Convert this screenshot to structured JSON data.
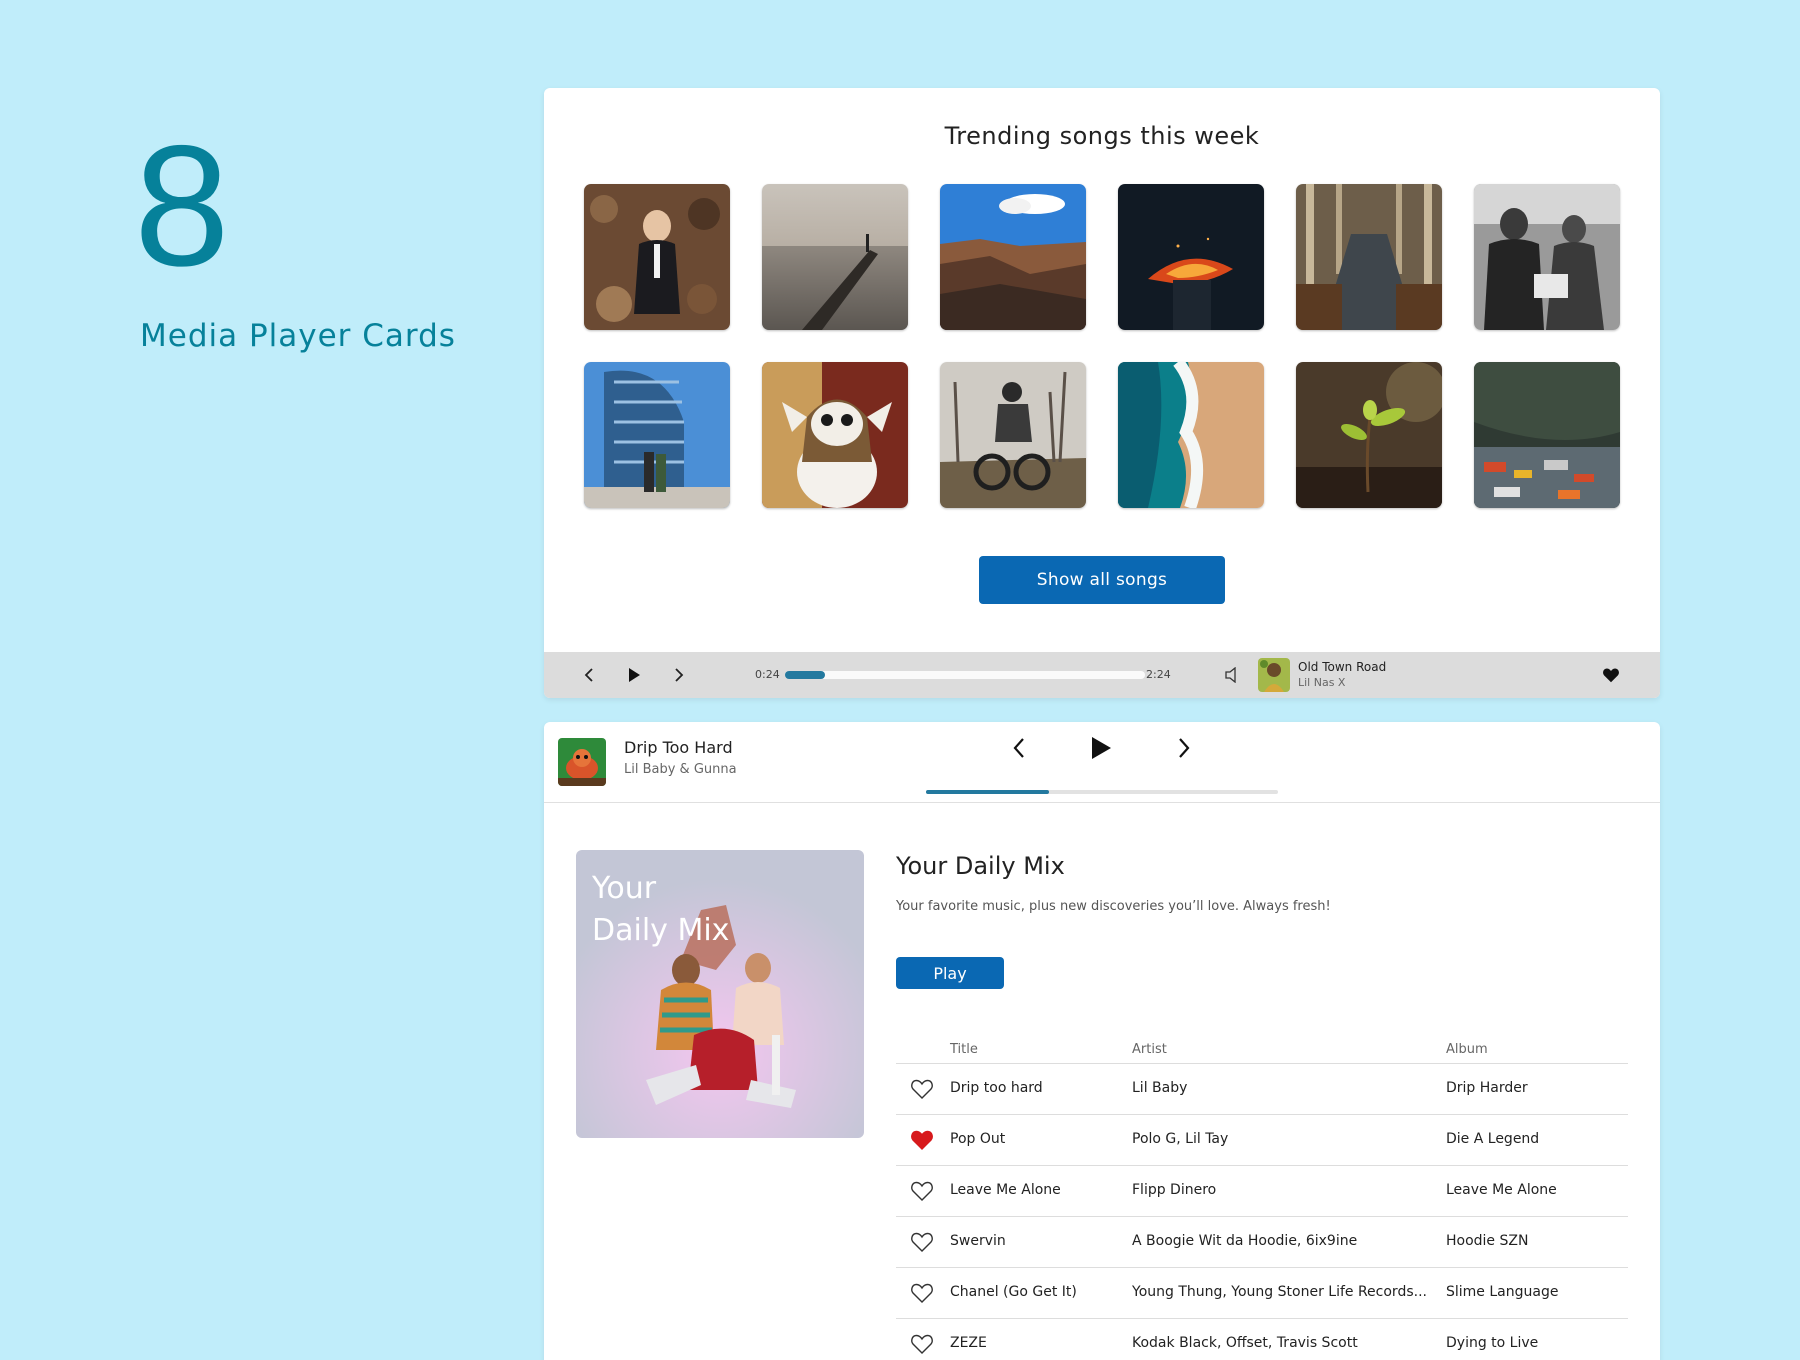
{
  "hero": {
    "number": "8",
    "label": "Media Player Cards"
  },
  "trending": {
    "title": "Trending songs this week",
    "tiles": [
      "portrait-in-leaves",
      "pier-at-sunset",
      "canyon-vista",
      "burning-sparks",
      "library-hall",
      "crowd-protest",
      "glass-tower",
      "furry-mascot",
      "motorbike-rider",
      "beach-waves",
      "sapling-sprout",
      "harbor-boats"
    ],
    "show_all_label": "Show all songs",
    "player": {
      "prev_icon": "chevron-left-icon",
      "play_icon": "play-icon",
      "next_icon": "chevron-right-icon",
      "elapsed": "0:24",
      "duration": "2:24",
      "progress": 0.11,
      "now_playing_title": "Old Town Road",
      "now_playing_artist": "Lil Nas X",
      "volume_icon": "speaker-icon",
      "like_icon": "heart-icon"
    }
  },
  "mini_player": {
    "title": "Drip Too Hard",
    "artist": "Lil Baby & Gunna",
    "progress": 0.35
  },
  "mix": {
    "art_text_line1": "Your",
    "art_text_line2": "Daily Mix",
    "heading": "Your Daily Mix",
    "description": "Your favorite music, plus new discoveries you’ll love. Always fresh!",
    "play_label": "Play",
    "columns": {
      "title": "Title",
      "artist": "Artist",
      "album": "Album"
    },
    "rows": [
      {
        "title": "Drip too hard",
        "artist": "Lil Baby",
        "album": "Drip Harder",
        "liked": false
      },
      {
        "title": "Pop Out",
        "artist": "Polo G, Lil Tay",
        "album": "Die A Legend",
        "liked": true
      },
      {
        "title": "Leave Me Alone",
        "artist": "Flipp Dinero",
        "album": "Leave Me Alone",
        "liked": false
      },
      {
        "title": "Swervin",
        "artist": "A Boogie Wit da Hoodie, 6ix9ine",
        "album": "Hoodie SZN",
        "liked": false
      },
      {
        "title": "Chanel (Go Get It)",
        "artist": "Young Thung, Young Stoner Life Records...",
        "album": "Slime Language",
        "liked": false
      },
      {
        "title": "ZEZE",
        "artist": "Kodak Black, Offset, Travis Scott",
        "album": "Dying to Live",
        "liked": false
      }
    ]
  },
  "colors": {
    "accent": "#0a68b3",
    "progress": "#23799f",
    "liked": "#d7191c",
    "hero": "#06819a"
  }
}
